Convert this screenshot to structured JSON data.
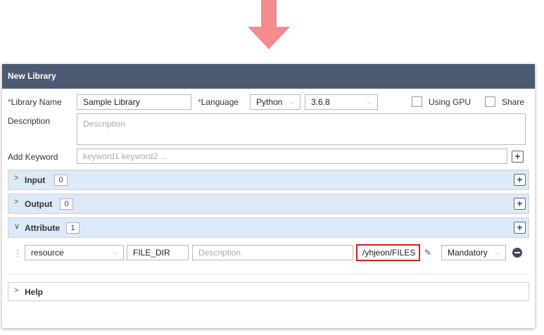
{
  "dialog": {
    "title": "New Library"
  },
  "form": {
    "library_name_required": "*",
    "library_name_label": "Library Name",
    "library_name_value": "Sample Library",
    "language_required": "*",
    "language_label": "Language",
    "language_value": "Python",
    "version_value": "3.6.8",
    "using_gpu_label": "Using GPU",
    "using_gpu_checked": false,
    "share_label": "Share",
    "share_checked": false,
    "description_label": "Description",
    "description_placeholder": "Description",
    "add_keyword_label": "Add Keyword",
    "keyword_placeholder": "keyword1 keyword2 ..."
  },
  "sections": {
    "input": {
      "label": "Input",
      "count": "0"
    },
    "output": {
      "label": "Output",
      "count": "0"
    },
    "attribute": {
      "label": "Attribute",
      "count": "1"
    },
    "help": {
      "label": "Help"
    }
  },
  "attribute_row": {
    "type_value": "resource",
    "key_value": "FILE_DIR",
    "description_placeholder": "Description",
    "value": "/yhjeon/FILES",
    "requirement_value": "Mandatory"
  },
  "icons": {
    "chevron_down": "⌵",
    "caret_right": ">",
    "caret_down": "∨",
    "plus": "+",
    "edit": "✎",
    "drag": "⋮⋮"
  },
  "colors": {
    "titlebar": "#4b5a73",
    "section_bg": "#dde9f6",
    "required": "#d9363e",
    "highlight": "#e0191c",
    "arrow": "#f48b8e"
  }
}
